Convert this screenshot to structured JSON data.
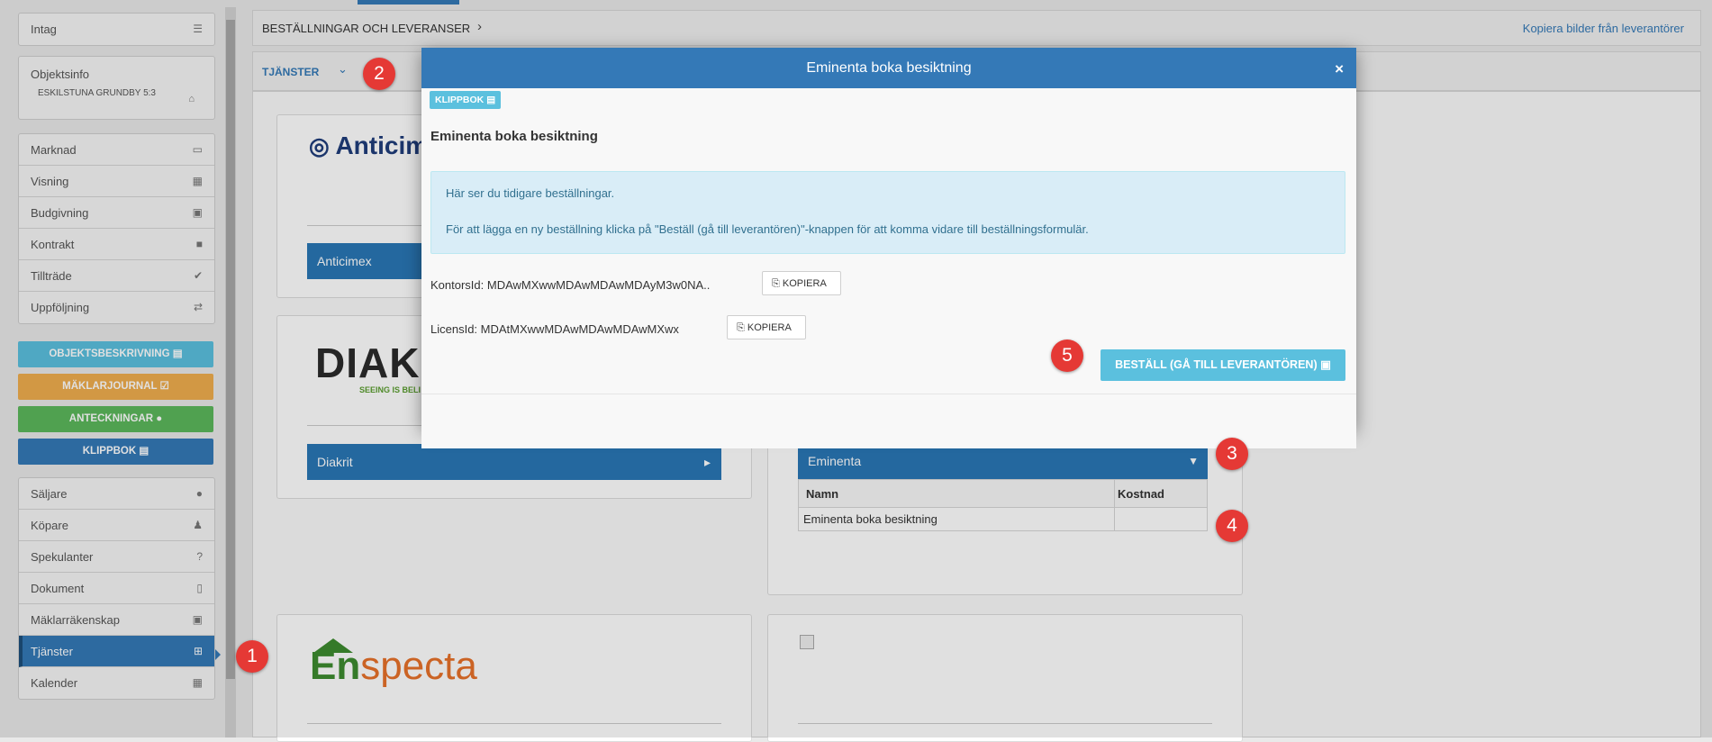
{
  "sidebar": {
    "intag": {
      "label": "Intag",
      "icon": "list-icon"
    },
    "objektsinfo": {
      "label": "Objektsinfo",
      "address": "ESKILSTUNA GRUNDBY 5:3",
      "icon": "home-icon"
    },
    "nav1": [
      {
        "label": "Marknad",
        "icon": "monitor-icon",
        "glyph": "▭"
      },
      {
        "label": "Visning",
        "icon": "calendar-icon",
        "glyph": "▦"
      },
      {
        "label": "Budgivning",
        "icon": "money-icon",
        "glyph": "▣"
      },
      {
        "label": "Kontrakt",
        "icon": "lock-icon",
        "glyph": "■"
      },
      {
        "label": "Tillträde",
        "icon": "check-icon",
        "glyph": "✔"
      },
      {
        "label": "Uppföljning",
        "icon": "exchange-icon",
        "glyph": "⇄"
      }
    ],
    "buttons": {
      "objektsbeskrivning": "OBJEKTSBESKRIVNING",
      "maklarjournal": "MÄKLARJOURNAL",
      "anteckningar": "ANTECKNINGAR",
      "klippbok": "KLIPPBOK"
    },
    "nav2": [
      {
        "label": "Säljare",
        "icon": "user-icon",
        "glyph": "●"
      },
      {
        "label": "Köpare",
        "icon": "person-icon",
        "glyph": "♟"
      },
      {
        "label": "Spekulanter",
        "icon": "question-icon",
        "glyph": "?"
      },
      {
        "label": "Dokument",
        "icon": "file-icon",
        "glyph": "▯"
      },
      {
        "label": "Mäklarräkenskap",
        "icon": "money-icon",
        "glyph": "▣"
      },
      {
        "label": "Tjänster",
        "icon": "plus-square-icon",
        "glyph": "⊞",
        "active": true
      },
      {
        "label": "Kalender",
        "icon": "calendar-icon",
        "glyph": "▦"
      }
    ]
  },
  "main": {
    "breadcrumb": "BESTÄLLNINGAR OCH LEVERANSER",
    "copy_images_link": "Kopiera bilder från leverantörer",
    "services_tab": "TJÄNSTER",
    "providers": {
      "anticimex": {
        "logo_text": "Anticim",
        "bar": "Anticimex"
      },
      "diakrit": {
        "logo_text": "DIAK",
        "tagline": "SEEING IS BELI",
        "bar": "Diakrit"
      },
      "eminenta": {
        "bar": "Eminenta",
        "col_name": "Namn",
        "col_cost": "Kostnad",
        "row_name": "Eminenta boka besiktning",
        "row_cost": ""
      },
      "enspecta": {
        "logo_en": "En",
        "logo_specta": "specta"
      }
    }
  },
  "modal": {
    "title": "Eminenta boka besiktning",
    "tag": "KLIPPBOK",
    "heading": "Eminenta boka besiktning",
    "info_line1": "Här ser du tidigare beställningar.",
    "info_line2": "För att lägga en ny beställning klicka på \"Beställ (gå till leverantören)\"-knappen för att komma vidare till beställningsformulär.",
    "kontors_label": "KontorsId: MDAwMXwwMDAwMDAwMDAyM3w0NA..",
    "licens_label": "LicensId: MDAtMXwwMDAwMDAwMDAwMXwx",
    "copy_label": "KOPIERA",
    "order_button": "BESTÄLL (GÅ TILL LEVERANTÖREN)"
  },
  "annotations": [
    "1",
    "2",
    "3",
    "4",
    "5"
  ],
  "colors": {
    "primary": "#3479b7",
    "info": "#5bc0de",
    "warning": "#f0ad4e",
    "success": "#5cb85c",
    "badge": "#e53935"
  }
}
